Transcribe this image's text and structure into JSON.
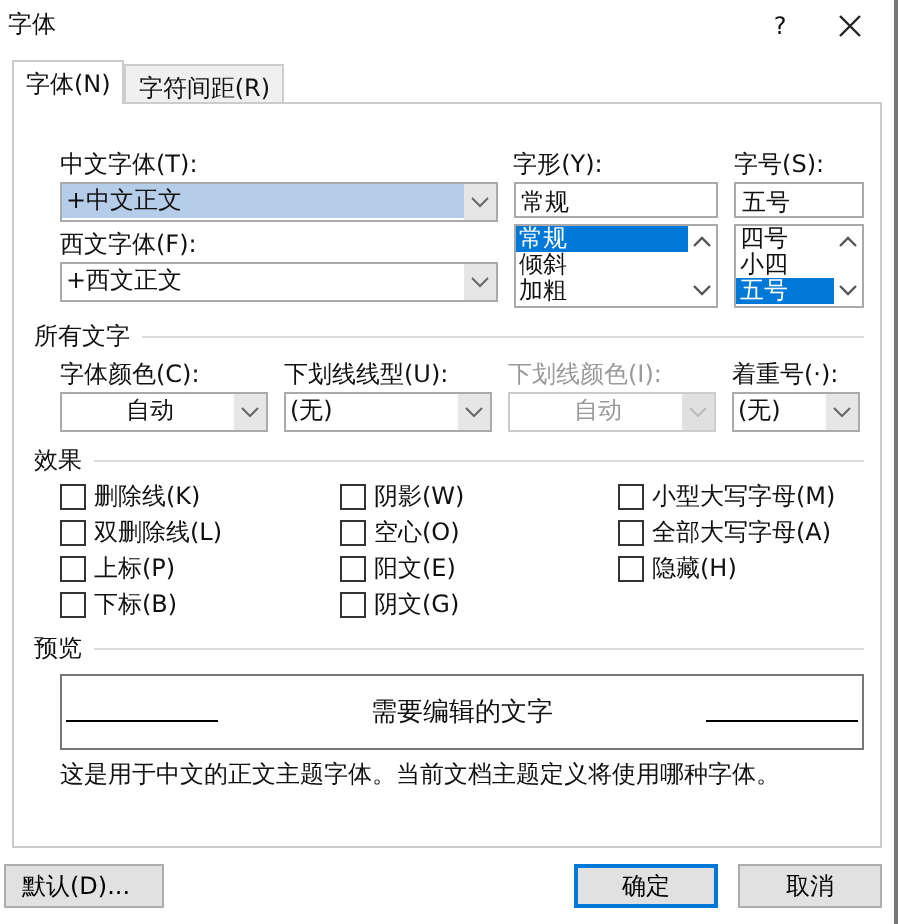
{
  "window": {
    "title": "字体",
    "help": "?"
  },
  "tabs": [
    {
      "label": "字体(N)",
      "selected": true
    },
    {
      "label": "字符间距(R)",
      "selected": false
    }
  ],
  "chinese_font": {
    "label": "中文字体(T):",
    "value": "+中文正文",
    "highlighted": true
  },
  "western_font": {
    "label": "西文字体(F):",
    "value": "+西文正文",
    "highlighted": false
  },
  "style": {
    "label": "字形(Y):",
    "value": "常规",
    "options": [
      {
        "label": "常规",
        "selected": true
      },
      {
        "label": "倾斜",
        "selected": false
      },
      {
        "label": "加粗",
        "selected": false
      }
    ]
  },
  "size": {
    "label": "字号(S):",
    "value": "五号",
    "options": [
      {
        "label": "四号",
        "selected": false
      },
      {
        "label": "小四",
        "selected": false
      },
      {
        "label": "五号",
        "selected": true
      }
    ]
  },
  "all_text": {
    "heading": "所有文字",
    "fields": [
      {
        "label": "字体颜色(C):",
        "value": "自动",
        "disabled": false,
        "centered": true
      },
      {
        "label": "下划线线型(U):",
        "value": "(无)",
        "disabled": false,
        "centered": false
      },
      {
        "label": "下划线颜色(I):",
        "value": "自动",
        "disabled": true,
        "centered": true
      },
      {
        "label": "着重号(·):",
        "value": "(无)",
        "disabled": false,
        "centered": false
      }
    ]
  },
  "effects": {
    "heading": "效果",
    "columns": [
      [
        {
          "label": "删除线(K)",
          "checked": false
        },
        {
          "label": "双删除线(L)",
          "checked": false
        },
        {
          "label": "上标(P)",
          "checked": false
        },
        {
          "label": "下标(B)",
          "checked": false
        }
      ],
      [
        {
          "label": "阴影(W)",
          "checked": false
        },
        {
          "label": "空心(O)",
          "checked": false
        },
        {
          "label": "阳文(E)",
          "checked": false
        },
        {
          "label": "阴文(G)",
          "checked": false
        }
      ],
      [
        {
          "label": "小型大写字母(M)",
          "checked": false
        },
        {
          "label": "全部大写字母(A)",
          "checked": false
        },
        {
          "label": "隐藏(H)",
          "checked": false
        }
      ]
    ]
  },
  "preview": {
    "heading": "预览",
    "sample": "需要编辑的文字",
    "description": "这是用于中文的正文主题字体。当前文档主题定义将使用哪种字体。"
  },
  "buttons": [
    {
      "label": "默认(D)...",
      "kind": "secondary"
    },
    {
      "label": "确定",
      "kind": "primary"
    },
    {
      "label": "取消",
      "kind": "normal"
    }
  ]
}
